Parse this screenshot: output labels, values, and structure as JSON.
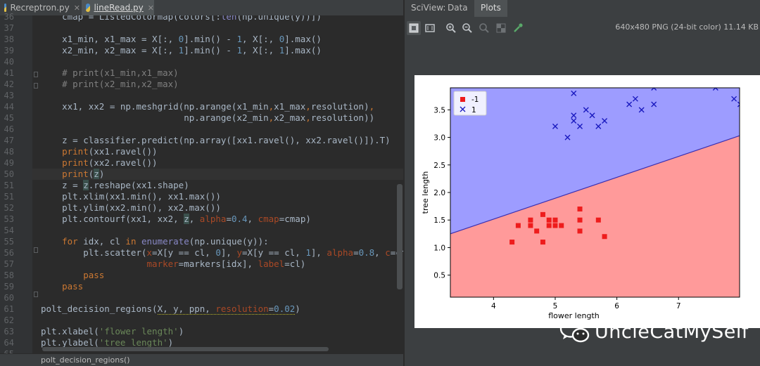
{
  "editor": {
    "tabs": [
      {
        "label": "Recreptron.py",
        "active": false
      },
      {
        "label": "lineRead.py",
        "active": true
      }
    ],
    "status_text": "polt_decision_regions()"
  },
  "sciview": {
    "title": "SciView:",
    "tabs": [
      "Data",
      "Plots"
    ],
    "active_tab": "Plots",
    "toolbar_icons": [
      "fit-icon",
      "actual-size-icon",
      "zoom-in-icon",
      "zoom-out-icon",
      "zoom-reset-icon",
      "grid-icon",
      "color-picker-icon"
    ],
    "image_info": "640x480 PNG (24-bit color) 11.14 KB"
  },
  "chart_data": {
    "type": "scatter",
    "xlabel": "flower length",
    "ylabel": "tree length",
    "xlim": [
      3.3,
      7.99
    ],
    "ylim": [
      0.1,
      3.9
    ],
    "xticks": [
      4,
      5,
      6,
      7
    ],
    "yticks": [
      0.5,
      1.0,
      1.5,
      2.0,
      2.5,
      3.0,
      3.5
    ],
    "legend_position": "top-left",
    "regions": [
      {
        "name": "-1",
        "color": "#ff9a9a"
      },
      {
        "name": "1",
        "color": "#9d9cff"
      }
    ],
    "boundary": [
      [
        3.3,
        1.25
      ],
      [
        7.99,
        3.03
      ]
    ],
    "series": [
      {
        "name": "-1",
        "marker": "s",
        "color": "#ee1c1c",
        "points": [
          [
            4.3,
            1.1
          ],
          [
            4.4,
            1.4
          ],
          [
            4.6,
            1.4
          ],
          [
            4.6,
            1.5
          ],
          [
            4.7,
            1.3
          ],
          [
            4.8,
            1.6
          ],
          [
            4.8,
            1.1
          ],
          [
            4.9,
            1.4
          ],
          [
            4.9,
            1.5
          ],
          [
            5.0,
            1.4
          ],
          [
            5.0,
            1.5
          ],
          [
            5.1,
            1.4
          ],
          [
            5.4,
            1.7
          ],
          [
            5.4,
            1.5
          ],
          [
            5.4,
            1.3
          ],
          [
            5.7,
            1.5
          ],
          [
            5.8,
            1.2
          ]
        ]
      },
      {
        "name": "1",
        "marker": "x",
        "color": "#1a1abf",
        "points": [
          [
            5.0,
            3.2
          ],
          [
            5.2,
            3.0
          ],
          [
            5.3,
            3.3
          ],
          [
            5.3,
            3.4
          ],
          [
            5.3,
            3.8
          ],
          [
            5.4,
            3.2
          ],
          [
            5.5,
            3.5
          ],
          [
            5.6,
            3.4
          ],
          [
            5.7,
            3.2
          ],
          [
            5.8,
            3.3
          ],
          [
            6.2,
            3.6
          ],
          [
            6.3,
            3.7
          ],
          [
            6.4,
            3.5
          ],
          [
            6.6,
            3.6
          ],
          [
            6.6,
            3.9
          ],
          [
            7.6,
            3.9
          ],
          [
            7.9,
            3.7
          ],
          [
            8.0,
            3.6
          ]
        ]
      }
    ]
  },
  "watermark": "UncleCatMySelf"
}
